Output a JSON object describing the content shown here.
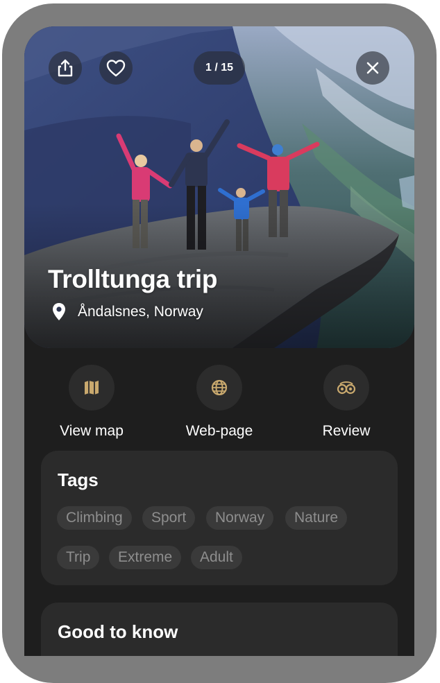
{
  "hero": {
    "title": "Trolltunga trip",
    "location": "Åndalsnes, Norway",
    "counter": "1 / 15"
  },
  "icons": {
    "share": "share-icon",
    "favorite": "heart-icon",
    "close": "close-icon",
    "location": "location-pin-icon",
    "map": "map-icon",
    "web": "globe-icon",
    "review": "tripadvisor-icon"
  },
  "actions": [
    {
      "label": "View map"
    },
    {
      "label": "Web-page"
    },
    {
      "label": "Review"
    }
  ],
  "tags": {
    "title": "Tags",
    "items": [
      "Climbing",
      "Sport",
      "Norway",
      "Nature",
      "Trip",
      "Extreme",
      "Adult"
    ]
  },
  "good_to_know": {
    "title": "Good to know"
  },
  "colors": {
    "background": "#1e1e1e",
    "card": "#2b2b2b",
    "tag": "#3a3a3a",
    "accent_icon": "#c9a96e",
    "frame": "#7d7d7d"
  }
}
